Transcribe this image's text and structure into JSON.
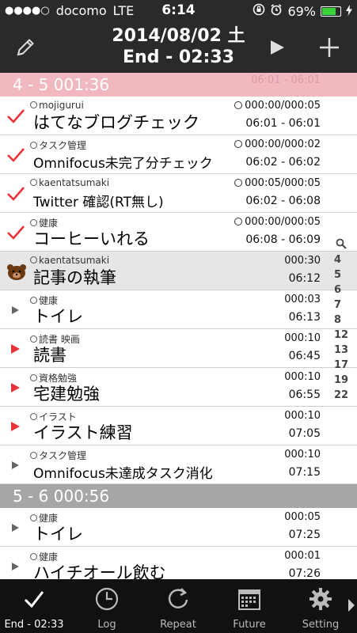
{
  "statusbar": {
    "signal": "●●●●○",
    "carrier": "docomo",
    "network": "LTE",
    "time": "6:14",
    "battery_text": "69%",
    "battery_level": 0.69
  },
  "navbar": {
    "date": "2014/08/02 土",
    "end_label": "End - 02:33"
  },
  "section1": {
    "title": "4 - 5    001:36",
    "ghost": "06:01 - 06:01"
  },
  "section2": {
    "title": "5 - 6    000:56"
  },
  "tasks1": [
    {
      "marker": "check",
      "category": "mojigurui",
      "name": "はてなブログチェック",
      "stat": "000:00/000:05",
      "time": "06:01 - 06:01"
    },
    {
      "marker": "check",
      "category": "タスク管理",
      "name": "Omnifocus未完了分チェック",
      "stat": "000:00/000:02",
      "time": "06:02 - 06:02"
    },
    {
      "marker": "check",
      "category": "kaentatsumaki",
      "name": "Twitter 確認(RT無し)",
      "stat": "000:05/000:05",
      "time": "06:02 - 06:08"
    },
    {
      "marker": "check",
      "category": "健康",
      "name": "コーヒーいれる",
      "stat": "000:00/000:05",
      "time": "06:08 - 06:09"
    },
    {
      "marker": "bear",
      "category": "kaentatsumaki",
      "name": "記事の執筆",
      "stat": "000:30",
      "time": "06:12"
    },
    {
      "marker": "play-gray",
      "category": "健康",
      "name": "トイレ",
      "stat": "000:03",
      "time": "06:13"
    },
    {
      "marker": "play-red",
      "category": "読書 映画",
      "name": "読書",
      "stat": "000:10",
      "time": "06:45"
    },
    {
      "marker": "play-red",
      "category": "資格勉強",
      "name": "宅建勉強",
      "stat": "000:10",
      "time": "06:55"
    },
    {
      "marker": "play-red",
      "category": "イラスト",
      "name": "イラスト練習",
      "stat": "000:10",
      "time": "07:05"
    },
    {
      "marker": "play-gray",
      "category": "タスク管理",
      "name": "Omnifocus未達成タスク消化",
      "stat": "000:10",
      "time": "07:15"
    }
  ],
  "tasks2": [
    {
      "marker": "play-gray",
      "category": "健康",
      "name": "トイレ",
      "stat": "000:05",
      "time": "07:25"
    },
    {
      "marker": "play-gray",
      "category": "健康",
      "name": "ハイチオール飲む",
      "stat": "000:01",
      "time": "07:26"
    }
  ],
  "index": [
    "4",
    "5",
    "6",
    "7",
    "8",
    "12",
    "13",
    "17",
    "19",
    "22"
  ],
  "tabs": [
    {
      "label": "End - 02:33",
      "icon": "checkmark-icon"
    },
    {
      "label": "Log",
      "icon": "clock-icon"
    },
    {
      "label": "Repeat",
      "icon": "repeat-icon"
    },
    {
      "label": "Future",
      "icon": "calendar-icon"
    },
    {
      "label": "Setting",
      "icon": "gear-icon"
    }
  ],
  "colors": {
    "check": "#e8333b",
    "play_red": "#e8333b",
    "play_gray": "#666666",
    "section_pink": "#f2b8c0",
    "section_gray": "#a6a6a6"
  }
}
